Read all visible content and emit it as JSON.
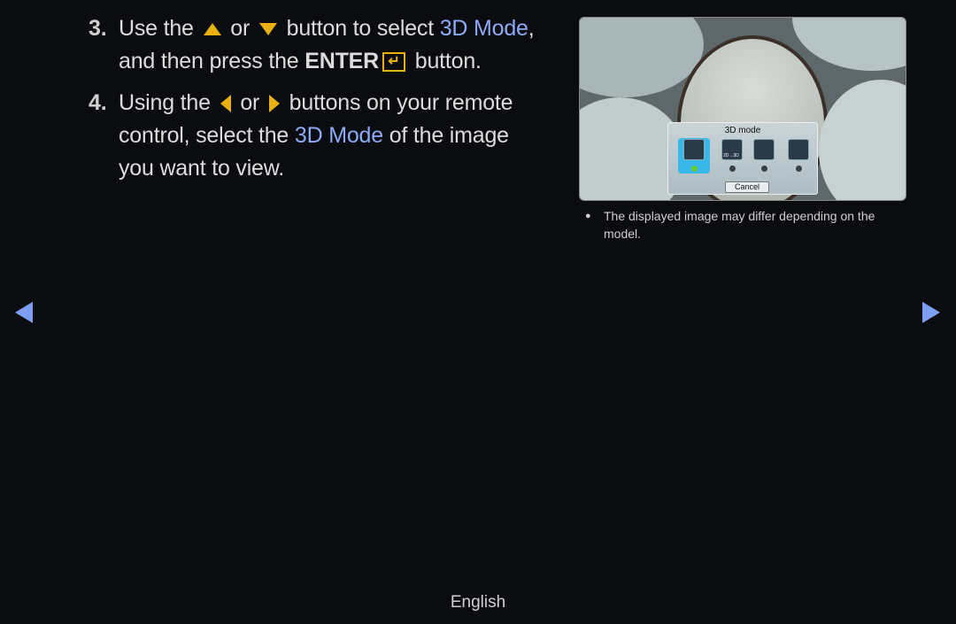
{
  "steps": [
    {
      "number": "3.",
      "part1": "Use the",
      "or": "or",
      "part2": "button to select",
      "highlight": "3D Mode",
      "part3": ",",
      "line2a": "and then press the",
      "enter": "ENTER",
      "line2b": "button."
    },
    {
      "number": "4.",
      "part1": "Using the",
      "or": "or",
      "part2": "buttons on your remote control, select the",
      "highlight": "3D Mode",
      "part3": "of the image you want to view."
    }
  ],
  "screenshot": {
    "dialog_title": "3D mode",
    "option_label": "2D→3D",
    "cancel": "Cancel",
    "selected_option": 1
  },
  "note": {
    "bullet": "●",
    "text": "The displayed image may differ depending on the model."
  },
  "nav": {
    "prev": "previous-page",
    "next": "next-page"
  },
  "footer": {
    "language": "English"
  },
  "colors": {
    "highlight": "#8eaaf6",
    "button_icon": "#e8b010",
    "nav_arrow": "#7d9ff2"
  }
}
